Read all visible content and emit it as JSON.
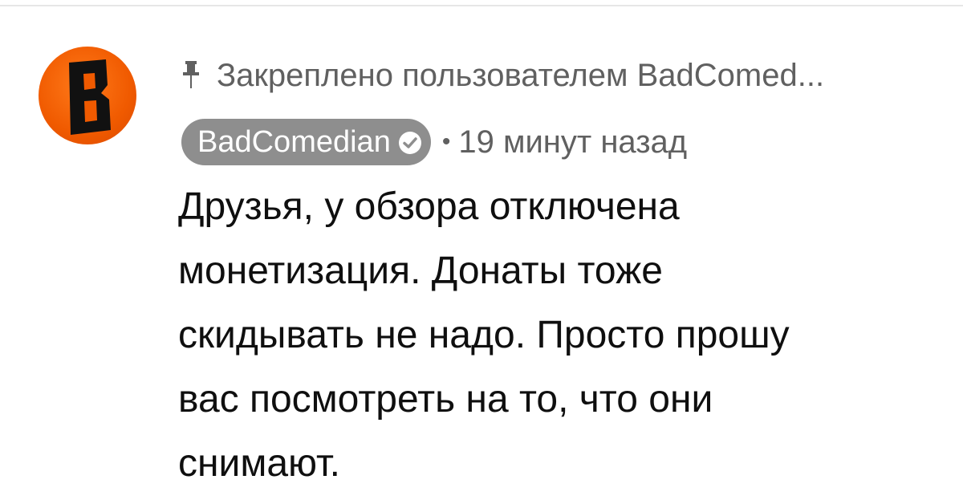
{
  "comment": {
    "avatar": {
      "letter": "B",
      "icon": "channel-avatar",
      "colors": {
        "bg": "#f05a00",
        "mark": "#111111"
      }
    },
    "pinned": {
      "icon": "pin-icon",
      "text": "Закреплено пользователем BadComed..."
    },
    "author": {
      "name": "BadComedian",
      "badge_icon": "verified-check-icon",
      "chip_color": "#8e8e8e"
    },
    "separator": "•",
    "timestamp": "19 минут назад",
    "body_lines": [
      "Друзья, у обзора отключена",
      "монетизация. Донаты тоже",
      "скидывать не надо. Просто прошу",
      "вас посмотреть на то, что они",
      "снимают."
    ]
  }
}
